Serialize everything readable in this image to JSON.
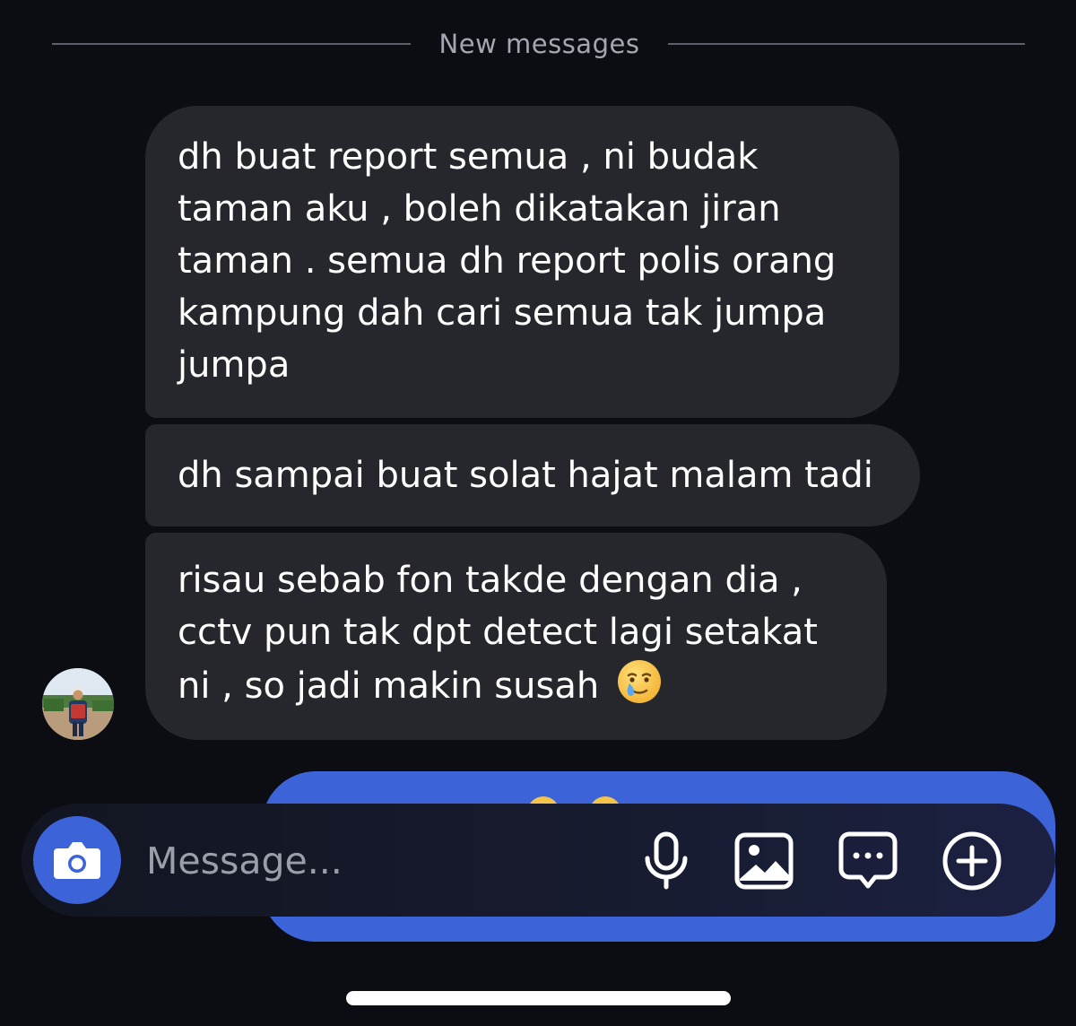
{
  "divider": {
    "label": "New messages"
  },
  "messages": [
    {
      "lines": [
        "dh buat report semua , ni budak",
        "taman aku , boleh dikatakan jiran",
        "taman . semua dh report polis orang",
        "kampung dah cari semua tak jumpa",
        "jumpa"
      ]
    },
    {
      "lines": [
        "dh sampai buat solat hajat malam tadi"
      ]
    },
    {
      "lines": [
        "risau sebab fon takde dengan dia ,",
        "cctv pun tak dpt detect lagi setakat",
        "ni , so jadi makin susah"
      ],
      "emoji": "crying-smile-emoji"
    }
  ],
  "composer": {
    "placeholder": "Message...",
    "value": ""
  },
  "icons": {
    "camera": "camera-icon",
    "mic": "microphone-icon",
    "gallery": "image-icon",
    "sticker": "chat-bubble-icon",
    "plus": "plus-circle-icon"
  },
  "colors": {
    "background": "#0b0d13",
    "incoming_bubble": "#25272d",
    "accent": "#3d63d9",
    "divider": "#5c6068"
  }
}
